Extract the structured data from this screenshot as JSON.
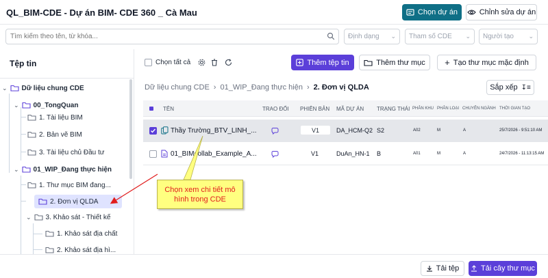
{
  "header": {
    "title": "QL_BIM-CDE - Dự án BIM- CDE 360 _ Cà Mau",
    "choose_project": "Chọn dự án",
    "edit_project": "Chỉnh sửa dự án",
    "accent": "#0f6f86"
  },
  "filters": {
    "search_placeholder": "Tìm kiếm theo tên, từ khóa...",
    "format": "Định dạng",
    "cde_param": "Tham số CDE",
    "creator": "Người tạo"
  },
  "sidebar": {
    "title": "Tệp tin",
    "tree": [
      {
        "label": "Dữ liệu chung CDE",
        "type": "folder",
        "expanded": true
      },
      {
        "label": "00_TongQuan",
        "type": "folder",
        "expanded": true
      },
      {
        "label": "1. Tài liệu BIM",
        "type": "folder"
      },
      {
        "label": "2. Bản vẽ BIM",
        "type": "folder"
      },
      {
        "label": "3. Tài liệu chủ Đầu tư",
        "type": "folder"
      },
      {
        "label": "01_WIP_Đang thực hiện",
        "type": "folder",
        "expanded": true
      },
      {
        "label": "1. Thư mục BIM đang...",
        "type": "folder"
      },
      {
        "label": "2. Đơn vị QLDA",
        "type": "folder",
        "selected": true
      },
      {
        "label": "3. Khảo sát - Thiết kế",
        "type": "folder",
        "expanded": true
      },
      {
        "label": "1. Khảo sát địa chất",
        "type": "folder"
      },
      {
        "label": "2. Khảo sát địa hì...",
        "type": "folder"
      }
    ]
  },
  "toolbar": {
    "select_all": "Chọn tất cả",
    "add_file": "Thêm tệp tin",
    "add_folder": "Thêm thư mục",
    "create_default": "Tạo thư mục mặc định",
    "sort": "Sắp xếp",
    "primary": "#5b3fd9"
  },
  "breadcrumb": [
    "Dữ liệu chung CDE",
    "01_WIP_Đang thực hiện",
    "2. Đơn vị QLDA"
  ],
  "table": {
    "headers": [
      "TÊN",
      "TRAO ĐỔI",
      "PHIÊN BẢN",
      "MÃ DỰ ÁN",
      "TRẠNG THÁI",
      "PHÂN KHU",
      "PHÂN LOẠI",
      "CHUYÊN NGÀNH",
      "THỜI GIAN TẠO"
    ],
    "rows": [
      {
        "name": "Thầy Trường_BTV_LINH_...",
        "version": "V1",
        "project_code": "DA_HCM-Q2",
        "status": "S2",
        "zone": "A02",
        "category": "M",
        "discipline": "A",
        "created": "25/7/2026 - 9:51:10 AM",
        "selected": true
      },
      {
        "name": "01_BIMcollab_Example_A...",
        "version": "V1",
        "project_code": "DuAn_HN-1",
        "status": "B",
        "zone": "A01",
        "category": "M",
        "discipline": "A",
        "created": "24/7/2026 - 11:13:15 AM",
        "selected": false
      }
    ]
  },
  "annotation": {
    "text": "Chọn xem chi tiết mô hình trong CDE",
    "color": "#e11d1d",
    "background": "#ffff80"
  },
  "footer": {
    "download": "Tải tệp",
    "upload_tree": "Tải cây thư mục"
  }
}
